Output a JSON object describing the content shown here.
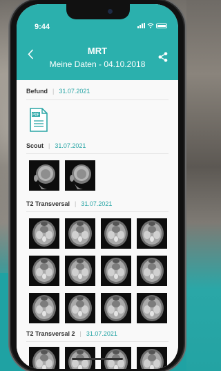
{
  "status_bar": {
    "time": "9:44"
  },
  "header": {
    "title": "MRT",
    "subtitle": "Meine Daten - 04.10.2018"
  },
  "sections": [
    {
      "name": "Befund",
      "date": "31.07.2021",
      "type": "pdf",
      "pdf_label": "PDF"
    },
    {
      "name": "Scout",
      "date": "31.07.2021",
      "type": "images",
      "count": 2
    },
    {
      "name": "T2 Transversal",
      "date": "31.07.2021",
      "type": "images",
      "count": 12
    },
    {
      "name": "T2 Transversal 2",
      "date": "31.07.2021",
      "type": "images",
      "count": 4
    }
  ],
  "colors": {
    "accent": "#2bb0ad",
    "date_text": "#2aa6a6",
    "background_teal": "#1fa2a3"
  },
  "icons": [
    "back-chevron-icon",
    "share-icon",
    "pdf-document-icon",
    "signal-icon",
    "wifi-icon",
    "battery-icon"
  ]
}
